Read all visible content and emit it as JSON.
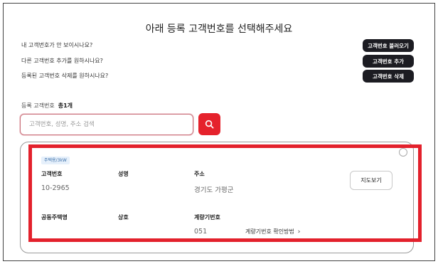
{
  "page": {
    "title": "아래 등록 고객번호를 선택해주세요"
  },
  "questions": [
    {
      "text": "내 고객번호가 안 보이시나요?",
      "button": "고객번호 불러오기"
    },
    {
      "text": "다른 고객번호 추가를 원하시나요?",
      "button": "고객번호 추가"
    },
    {
      "text": "등록된 고객번호 삭제를 원하시나요?",
      "button": "고객번호 삭제"
    }
  ],
  "registered": {
    "label": "등록 고객번호",
    "count": "총1개"
  },
  "search": {
    "placeholder": "고객번호, 성명, 주소 검색",
    "value": "",
    "icon": "search-icon"
  },
  "card": {
    "badge": "주택용/3kW",
    "customer_no_label": "고객번호",
    "customer_no": "10-2965",
    "name_label": "성명",
    "name": "",
    "address_label": "주소",
    "address": "경기도 가평군",
    "map_button": "지도보기",
    "complex_label": "공동주택명",
    "complex": "",
    "trade_name_label": "상호",
    "trade_name": "",
    "meter_label": "계량기번호",
    "meter_no": "051",
    "meter_help_link": "계량기번호 확인방법",
    "link_icon": "chevron-right-icon"
  },
  "colors": {
    "accent_red": "#e5222c",
    "dark_button": "#1c1c22",
    "highlight_border": "#e3212c",
    "badge_bg": "#e6f0fb",
    "badge_text": "#3a6ea8"
  }
}
